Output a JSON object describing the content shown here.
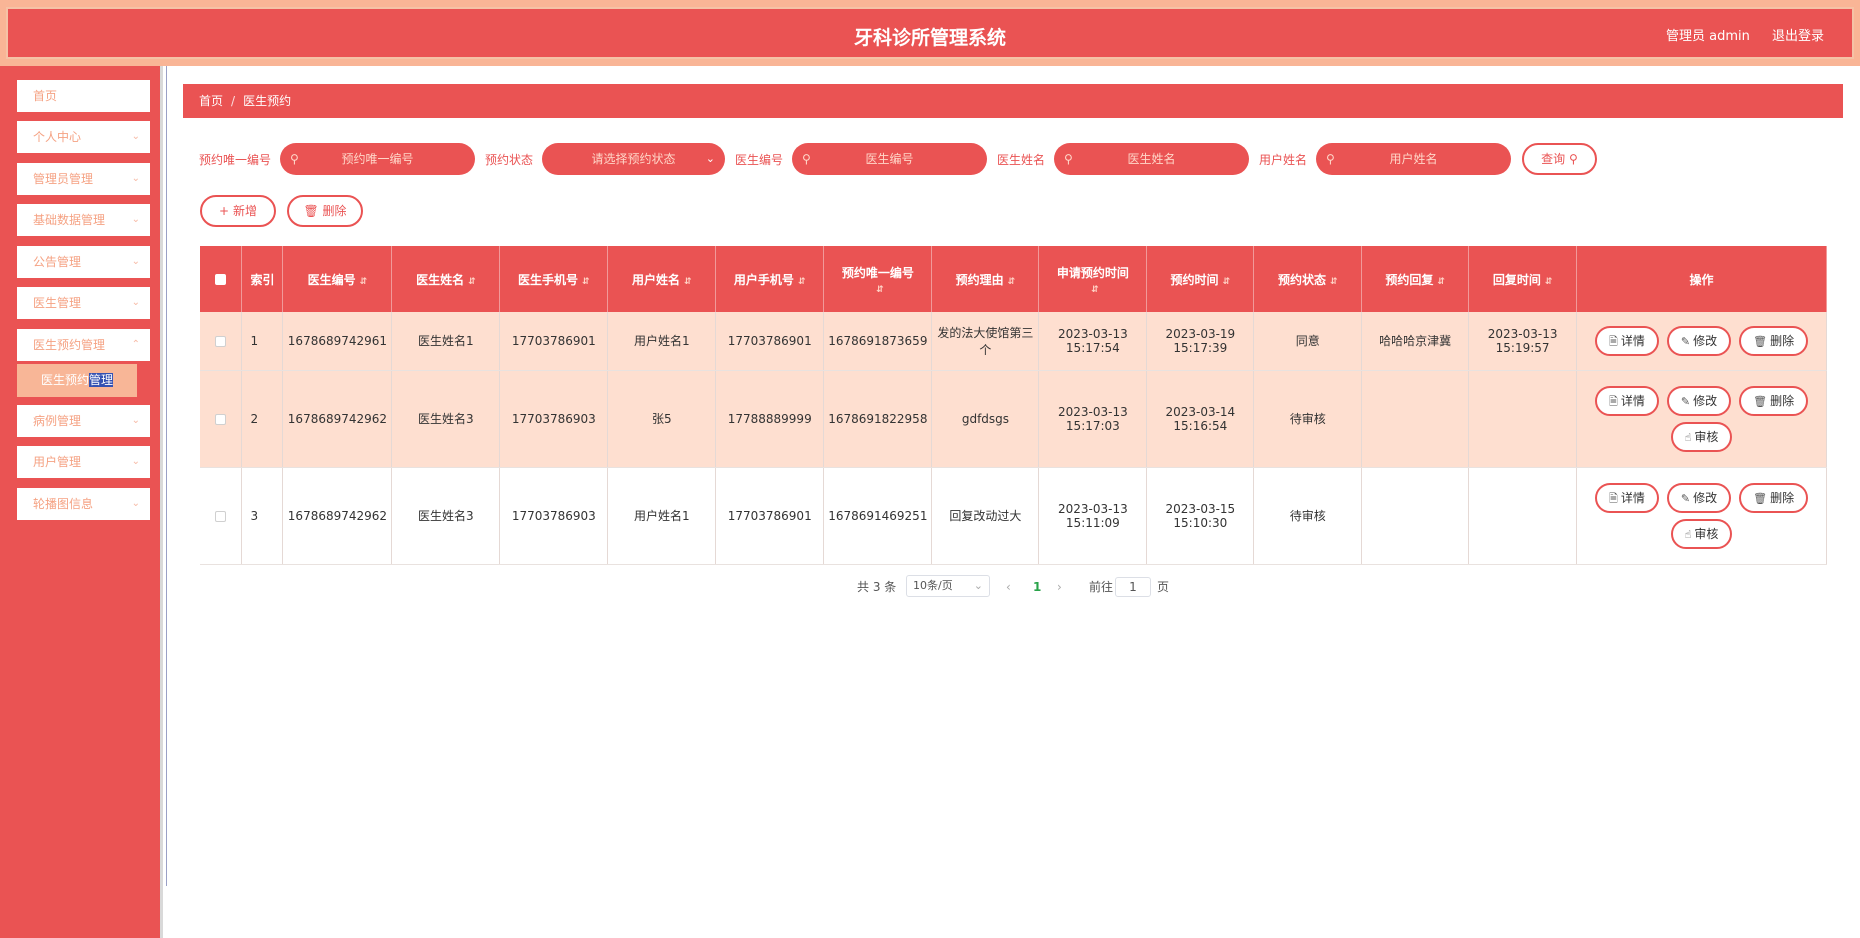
{
  "header": {
    "title": "牙科诊所管理系统",
    "user": "管理员 admin",
    "logout": "退出登录"
  },
  "sidebar": {
    "items": [
      {
        "label": "首页"
      },
      {
        "label": "个人中心"
      },
      {
        "label": "管理员管理"
      },
      {
        "label": "基础数据管理"
      },
      {
        "label": "公告管理"
      },
      {
        "label": "医生管理"
      },
      {
        "label": "医生预约管理"
      },
      {
        "label": "病例管理"
      },
      {
        "label": "用户管理"
      },
      {
        "label": "轮播图信息"
      }
    ],
    "sub_item_a": "医生预约",
    "sub_item_b": "管理"
  },
  "breadcrumb": {
    "home": "首页",
    "sep": "/",
    "current": "医生预约"
  },
  "search": {
    "label1": "预约唯一编号",
    "ph1": "预约唯一编号",
    "label2": "预约状态",
    "ph2": "请选择预约状态",
    "label3": "医生编号",
    "ph3": "医生编号",
    "label4": "医生姓名",
    "ph4": "医生姓名",
    "label5": "用户姓名",
    "ph5": "用户姓名",
    "query": "查询"
  },
  "actions": {
    "add": "新增",
    "delete": "删除"
  },
  "table": {
    "headers": [
      "索引",
      "医生编号",
      "医生姓名",
      "医生手机号",
      "用户姓名",
      "用户手机号",
      "预约唯一编号",
      "预约理由",
      "申请预约时间",
      "预约时间",
      "预约状态",
      "预约回复",
      "回复时间",
      "操作"
    ],
    "rows": [
      {
        "idx": "1",
        "doc_no": "1678689742961",
        "doc_name": "医生姓名1",
        "doc_phone": "17703786901",
        "user_name": "用户姓名1",
        "user_phone": "17703786901",
        "appt_no": "1678691873659",
        "reason": "发的法大使馆第三个",
        "apply_time": "2023-03-13 15:17:54",
        "appt_time": "2023-03-19 15:17:39",
        "status": "同意",
        "reply": "哈哈哈京津冀",
        "reply_time": "2023-03-13 15:19:57"
      },
      {
        "idx": "2",
        "doc_no": "1678689742962",
        "doc_name": "医生姓名3",
        "doc_phone": "17703786903",
        "user_name": "张5",
        "user_phone": "17788889999",
        "appt_no": "1678691822958",
        "reason": "gdfdsgs",
        "apply_time": "2023-03-13 15:17:03",
        "appt_time": "2023-03-14 15:16:54",
        "status": "待审核",
        "reply": "",
        "reply_time": ""
      },
      {
        "idx": "3",
        "doc_no": "1678689742962",
        "doc_name": "医生姓名3",
        "doc_phone": "17703786903",
        "user_name": "用户姓名1",
        "user_phone": "17703786901",
        "appt_no": "1678691469251",
        "reason": "回复改动过大",
        "apply_time": "2023-03-13 15:11:09",
        "appt_time": "2023-03-15 15:10:30",
        "status": "待审核",
        "reply": "",
        "reply_time": ""
      }
    ],
    "ops": {
      "detail": "详情",
      "edit": "修改",
      "delete": "删除",
      "audit": "审核"
    }
  },
  "pagination": {
    "total": "共 3 条",
    "page_size": "10条/页",
    "current": "1",
    "goto": "前往",
    "page_input": "1",
    "page_unit": "页"
  },
  "colors": {
    "primary": "#ea5353",
    "header_border": "#f9b596",
    "row_highlight": "#fedfd0"
  }
}
